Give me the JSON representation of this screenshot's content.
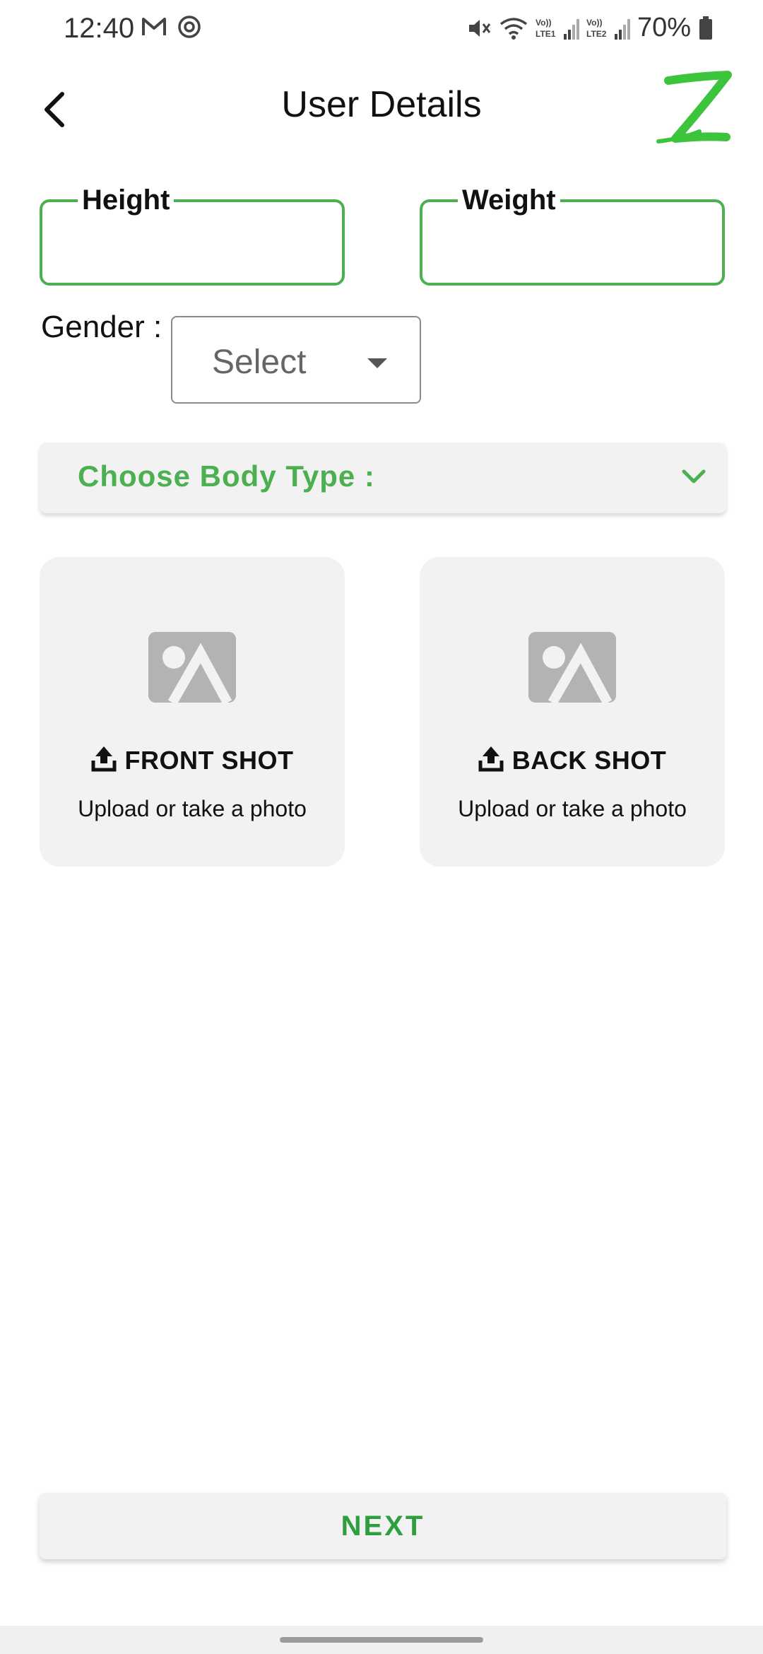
{
  "status_bar": {
    "time": "12:40",
    "left_icons": [
      "gmail-icon",
      "sync-icon"
    ],
    "right_icons": [
      "mute-icon",
      "wifi-icon",
      "signal-lte1-icon",
      "signal-lte2-icon"
    ],
    "battery_percent": "70%"
  },
  "header": {
    "title": "User Details",
    "back_icon": "back-arrow-icon",
    "logo_letter": "Z"
  },
  "form": {
    "height_label": "Height",
    "height_value": "",
    "weight_label": "Weight",
    "weight_value": "",
    "gender_label": "Gender :",
    "gender_select": "Select",
    "body_type_label": "Choose Body Type :"
  },
  "uploads": [
    {
      "title": "FRONT SHOT",
      "subtitle": "Upload or take a photo"
    },
    {
      "title": "BACK SHOT",
      "subtitle": "Upload or take a photo"
    }
  ],
  "next_label": "NEXT",
  "colors": {
    "accent_green": "#4caf50",
    "next_text": "#2e9e3e",
    "card_bg": "#f2f2f2",
    "logo_green": "#3dc43d"
  }
}
